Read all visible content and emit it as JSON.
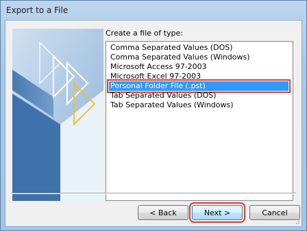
{
  "window": {
    "title": "Export to a File"
  },
  "dialog": {
    "prompt": "Create a file of type:",
    "file_types": [
      "Comma Separated Values (DOS)",
      "Comma Separated Values (Windows)",
      "Microsoft Access 97-2003",
      "Microsoft Excel 97-2003",
      "Personal Folder File (.pst)",
      "Tab Separated Values (DOS)",
      "Tab Separated Values (Windows)"
    ],
    "selected_index": 4
  },
  "buttons": {
    "back": "< Back",
    "next": "Next >",
    "cancel": "Cancel"
  },
  "colors": {
    "selection": "#3399ff",
    "highlight_box": "#e03a2c"
  }
}
